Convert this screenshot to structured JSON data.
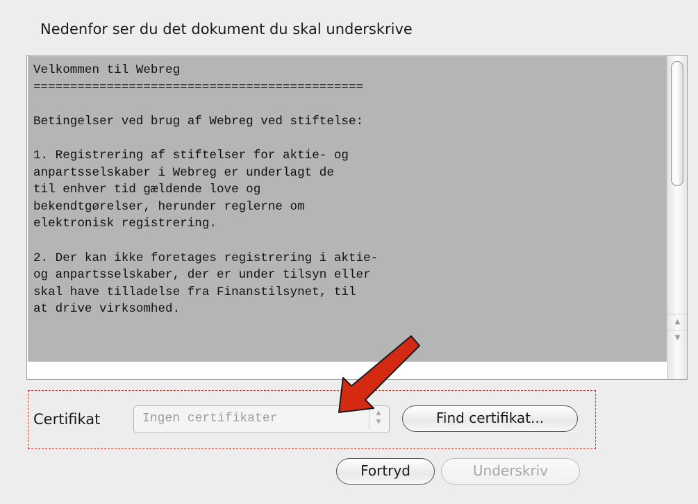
{
  "header": {
    "title": "Nedenfor ser du det dokument du skal underskrive"
  },
  "document": {
    "lines": [
      "Velkommen til Webreg",
      "=============================================",
      "",
      "Betingelser ved brug af Webreg ved stiftelse:",
      "",
      "1. Registrering af stiftelser for aktie- og",
      "anpartsselskaber i Webreg er underlagt de",
      "til enhver tid gældende love og",
      "bekendtgørelser, herunder reglerne om",
      "elektronisk registrering.",
      "",
      "2. Der kan ikke foretages registrering i aktie-",
      "og anpartsselskaber, der er under tilsyn eller",
      "skal have tilladelse fra Finanstilsynet, til",
      "at drive virksomhed."
    ]
  },
  "certificate": {
    "label": "Certifikat",
    "select_value": "Ingen certifikater",
    "find_button": "Find certifikat..."
  },
  "actions": {
    "cancel": "Fortryd",
    "sign": "Underskriv"
  },
  "colors": {
    "document_background": "#b5b5b5",
    "highlight_box": "#c0392b",
    "annotation_arrow": "#d42a12"
  },
  "icons": {
    "scroll_up": "scroll-up-arrow-icon",
    "scroll_down": "scroll-down-arrow-icon",
    "select_stepper": "updown-stepper-icon",
    "annotation": "red-pointer-arrow-icon"
  }
}
